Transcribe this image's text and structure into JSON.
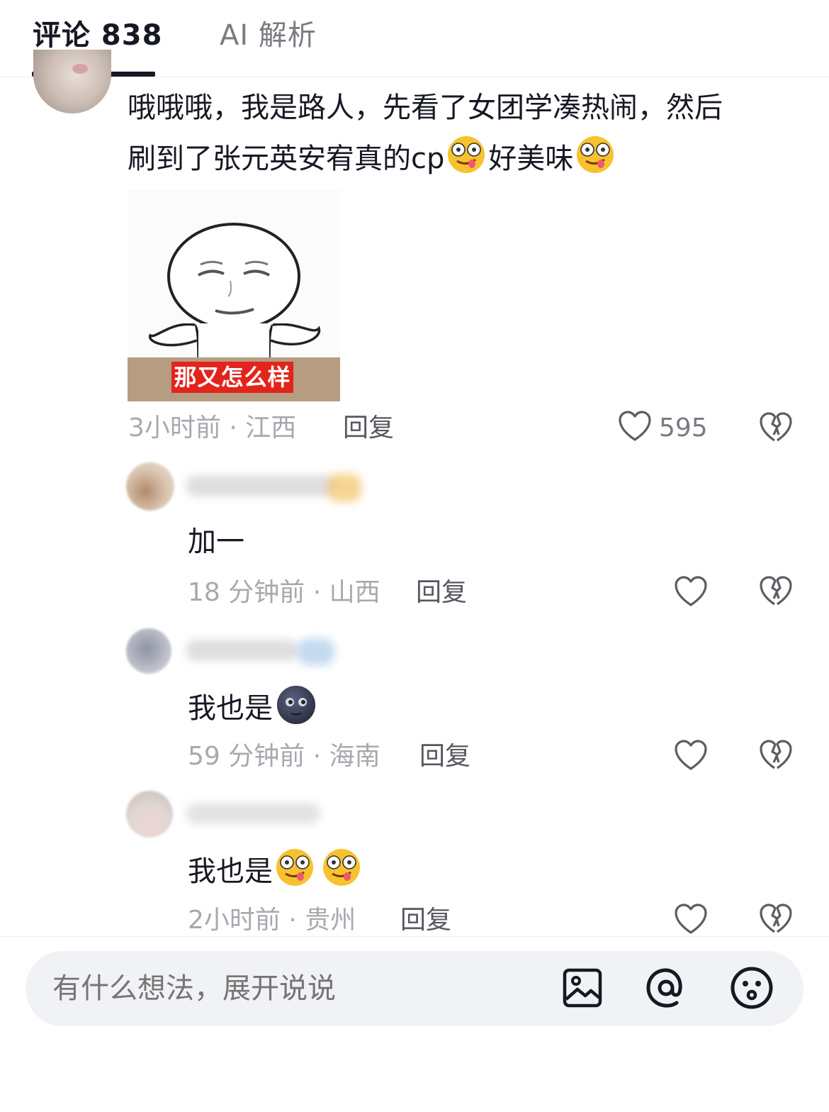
{
  "tabs": {
    "comments_label": "评论 838",
    "ai_label": "AI 解析"
  },
  "main_comment": {
    "text_line1": "哦哦哦，我是路人，先看了女团学凑热闹，然后",
    "text_line2_a": "刷到了张元英安宥真的cp",
    "text_line2_b": "好美味",
    "sticker_caption": "那又怎么样",
    "time_location": "3小时前 · 江西",
    "reply_label": "回复",
    "like_count": "595"
  },
  "replies": [
    {
      "text": "加一",
      "time_location": "18 分钟前 · 山西",
      "reply_label": "回复"
    },
    {
      "text": "我也是",
      "time_location": "59 分钟前 · 海南",
      "reply_label": "回复"
    },
    {
      "text": "我也是",
      "time_location": "2小时前 · 贵州",
      "reply_label": "回复"
    }
  ],
  "input": {
    "placeholder": "有什么想法，展开说说"
  },
  "icons": [
    "heart-icon",
    "broken-heart-icon",
    "image-icon",
    "at-icon",
    "smiley-icon",
    "drooling-emoji-icon",
    "new-moon-face-icon"
  ]
}
